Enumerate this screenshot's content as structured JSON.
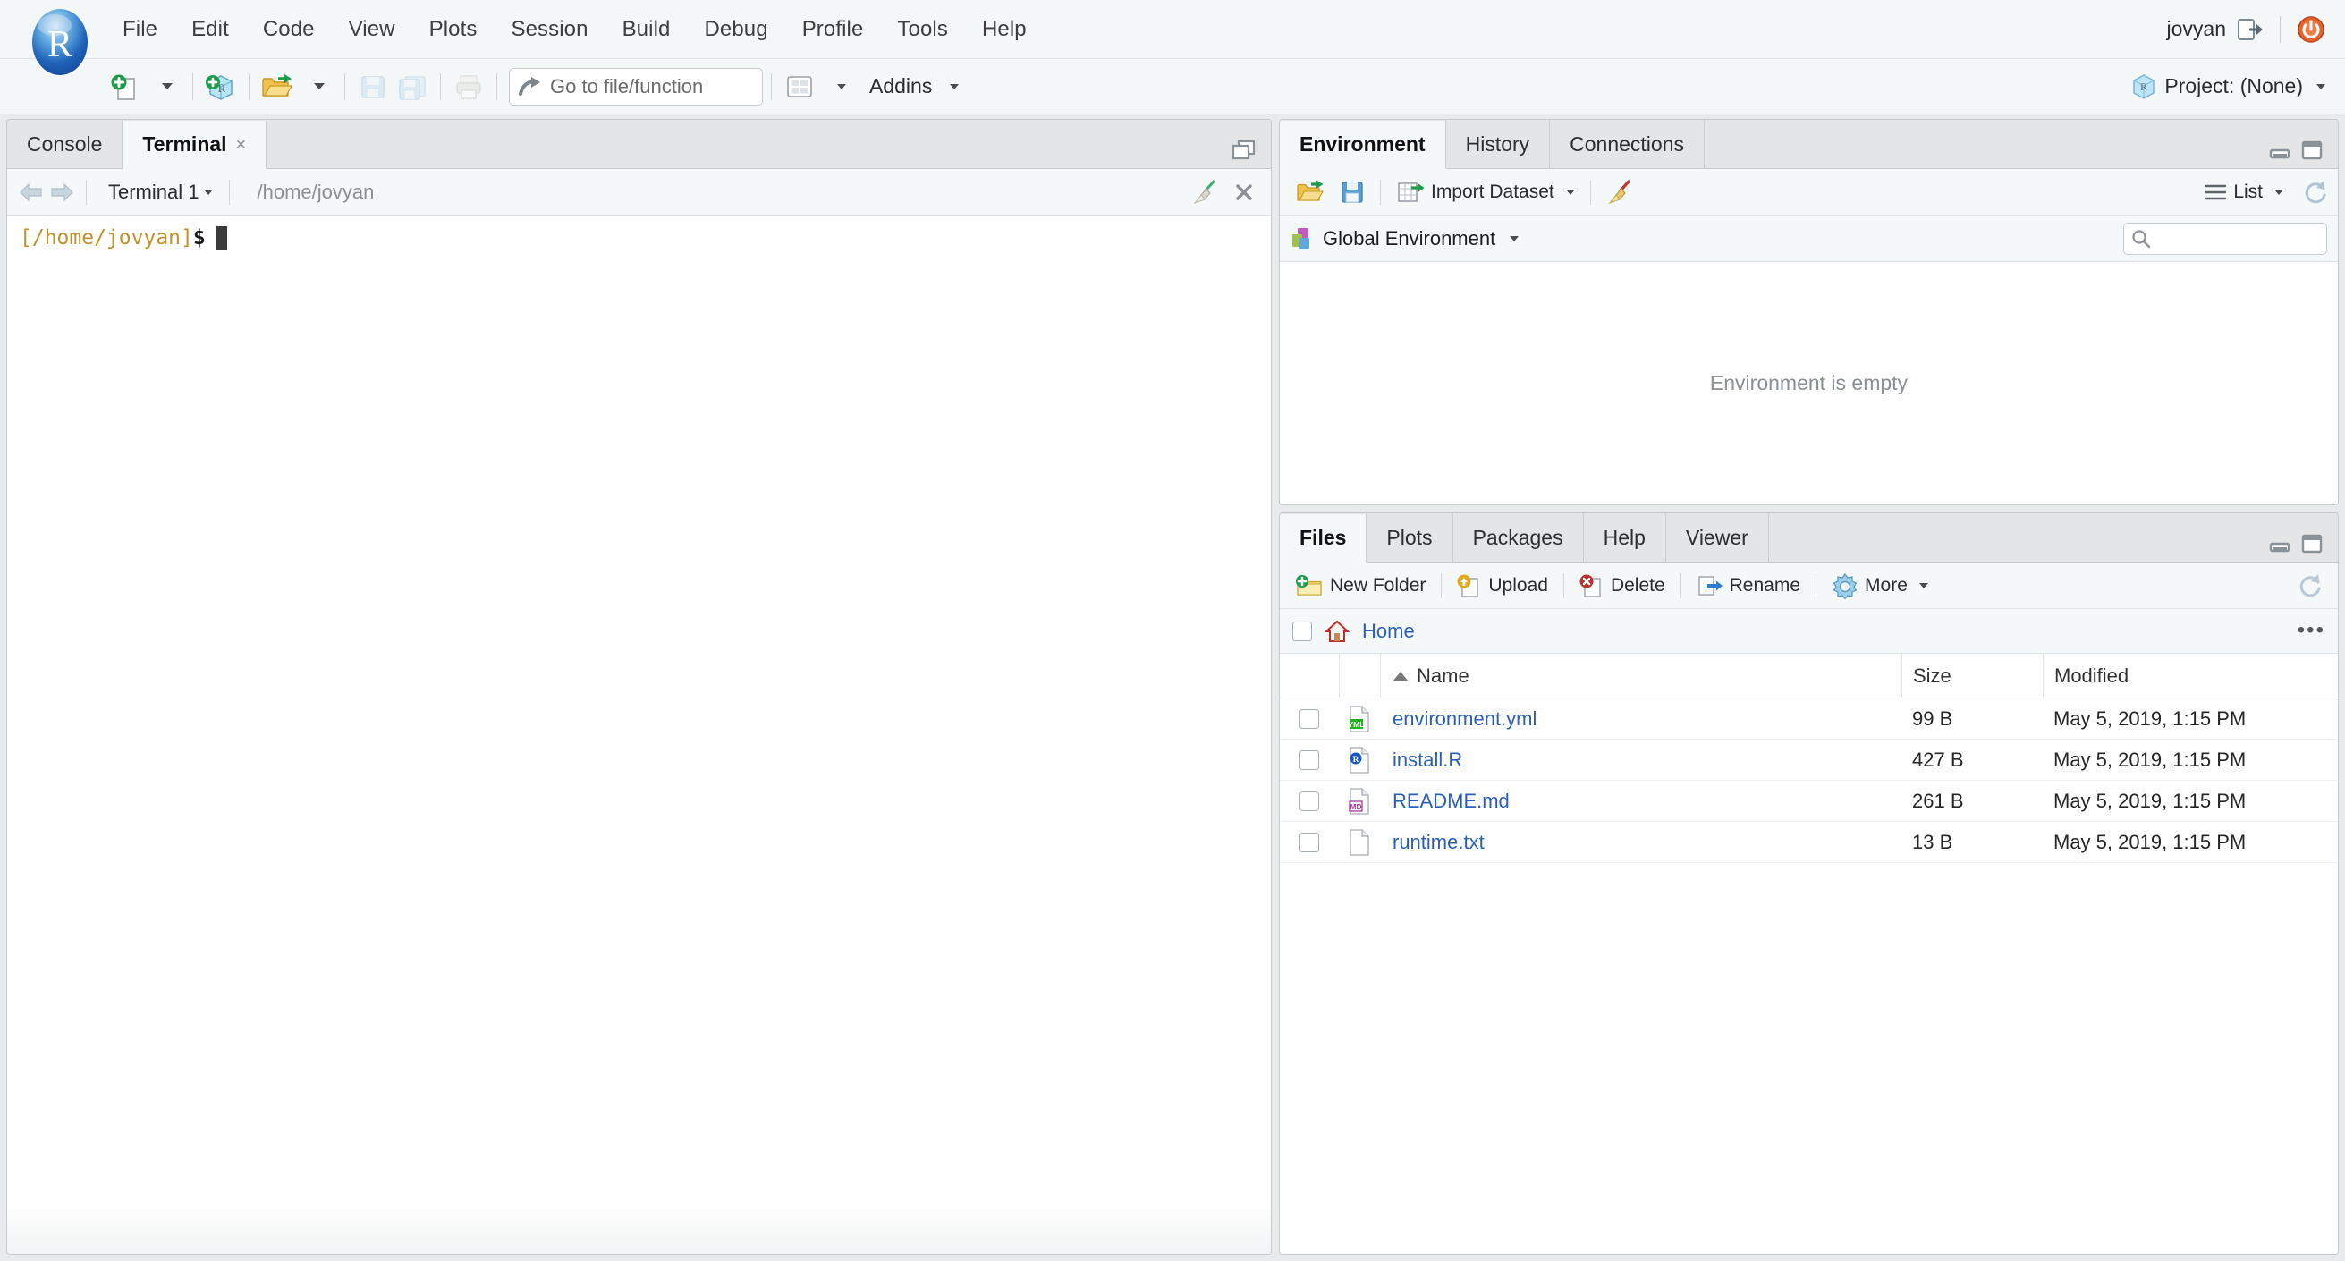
{
  "header": {
    "logo": "r-logo-icon",
    "menu": [
      {
        "label": "File"
      },
      {
        "label": "Edit"
      },
      {
        "label": "Code"
      },
      {
        "label": "View"
      },
      {
        "label": "Plots"
      },
      {
        "label": "Session"
      },
      {
        "label": "Build"
      },
      {
        "label": "Debug"
      },
      {
        "label": "Profile"
      },
      {
        "label": "Tools"
      },
      {
        "label": "Help"
      }
    ],
    "username": "jovyan",
    "signout_icon": "sign-out-icon",
    "quit_icon": "power-quit-icon"
  },
  "toolbar": {
    "new_file_icon": "new-file-icon",
    "new_project_icon": "new-project-icon",
    "open_file_icon": "open-folder-icon",
    "save_icon": "save-icon",
    "save_all_icon": "save-all-icon",
    "print_icon": "print-icon",
    "goto_placeholder": "Go to file/function",
    "goto_icon": "goto-arrow-icon",
    "panes_icon": "workspace-panes-icon",
    "addins_label": "Addins",
    "project_label": "Project: (None)",
    "project_icon": "r-project-cube-icon"
  },
  "console_pane": {
    "tabs": [
      {
        "label": "Console",
        "active": false,
        "closable": false
      },
      {
        "label": "Terminal",
        "active": true,
        "closable": true,
        "close_glyph": "×"
      }
    ],
    "maximize_icon": "restore-pane-icon",
    "terminal": {
      "back_icon": "back-arrow-icon",
      "forward_icon": "forward-arrow-icon",
      "session_label": "Terminal 1",
      "path": "/home/jovyan",
      "clear_icon": "broom-clear-icon",
      "close_icon": "close-terminal-icon",
      "prompt_path": "[/home/jovyan]",
      "prompt_symbol": "$",
      "cursor": "block-cursor"
    }
  },
  "environment_pane": {
    "tabs": [
      {
        "label": "Environment",
        "active": true
      },
      {
        "label": "History",
        "active": false
      },
      {
        "label": "Connections",
        "active": false
      }
    ],
    "minimize_icon": "minimize-pane-icon",
    "maximize_icon": "maximize-pane-icon",
    "toolbar": {
      "load_icon": "open-folder-icon",
      "save_icon": "save-disk-icon",
      "import_label": "Import Dataset",
      "import_icon": "import-dataset-icon",
      "clear_icon": "broom-clear-icon",
      "view_mode": "List",
      "view_icon": "list-view-icon",
      "refresh_icon": "refresh-icon"
    },
    "scope_label": "Global Environment",
    "scope_icon": "packages-cube-icon",
    "search_icon": "search-icon",
    "search_value": "",
    "empty_message": "Environment is empty"
  },
  "files_pane": {
    "tabs": [
      {
        "label": "Files",
        "active": true
      },
      {
        "label": "Plots",
        "active": false
      },
      {
        "label": "Packages",
        "active": false
      },
      {
        "label": "Help",
        "active": false
      },
      {
        "label": "Viewer",
        "active": false
      }
    ],
    "minimize_icon": "minimize-pane-icon",
    "maximize_icon": "maximize-pane-icon",
    "toolbar": {
      "new_folder_label": "New Folder",
      "new_folder_icon": "new-folder-icon",
      "upload_label": "Upload",
      "upload_icon": "upload-icon",
      "delete_label": "Delete",
      "delete_icon": "delete-icon",
      "rename_label": "Rename",
      "rename_icon": "rename-icon",
      "more_label": "More",
      "more_icon": "gear-icon",
      "refresh_icon": "refresh-icon"
    },
    "breadcrumb": {
      "home_icon": "home-icon",
      "home_label": "Home",
      "more_glyph": "•••"
    },
    "columns": [
      "Name",
      "Size",
      "Modified"
    ],
    "sort_column": "Name",
    "sort_direction": "asc",
    "files": [
      {
        "name": "environment.yml",
        "size": "99 B",
        "modified": "May 5, 2019, 1:15 PM",
        "icon": "yml-file-icon",
        "badge": "YML",
        "badge_color": "#1eb51e"
      },
      {
        "name": "install.R",
        "size": "427 B",
        "modified": "May 5, 2019, 1:15 PM",
        "icon": "r-file-icon",
        "badge": "R",
        "badge_color": "#1857c4"
      },
      {
        "name": "README.md",
        "size": "261 B",
        "modified": "May 5, 2019, 1:15 PM",
        "icon": "md-file-icon",
        "badge": "MD",
        "badge_color": "#a4389c"
      },
      {
        "name": "runtime.txt",
        "size": "13 B",
        "modified": "May 5, 2019, 1:15 PM",
        "icon": "text-file-icon",
        "badge": "",
        "badge_color": "#8a8f93"
      }
    ]
  },
  "colors": {
    "link": "#2b5fb5",
    "prompt": "#c2922c",
    "chrome": "#f4f7f8",
    "tab_inactive": "#e3e5e7",
    "border": "#c5cacd"
  }
}
